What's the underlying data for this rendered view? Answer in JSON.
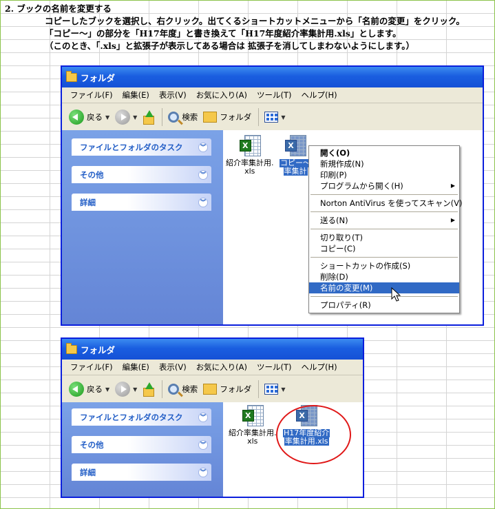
{
  "instructions": {
    "title": "2. ブックの名前を変更する",
    "line1": "コピーしたブックを選択し、右クリック。出てくるショートカットメニューから「名前の変更」をクリック。",
    "line2": "「コピー～」の部分を「H17年度」と書き換えて「H17年度紹介率集計用.xls」とします。",
    "line3": "（このとき、「.xls」と拡張子が表示してある場合は 拡張子を消してしまわないようにします。）"
  },
  "window_top": {
    "title": "フォルダ",
    "menu": [
      "ファイル(F)",
      "編集(E)",
      "表示(V)",
      "お気に入り(A)",
      "ツール(T)",
      "ヘルプ(H)"
    ],
    "toolbar": {
      "back": "戻る",
      "search": "検索",
      "folders": "フォルダ"
    },
    "tasks": [
      "ファイルとフォルダのタスク",
      "その他",
      "詳細"
    ],
    "files": [
      {
        "name_line1": "紹介率集計用.",
        "name_line2": "xls",
        "selected": false
      },
      {
        "name_line1": "コピー～",
        "name_line2": "率集計",
        "selected": true
      }
    ],
    "context_menu": {
      "group1": [
        "開く(O)",
        "新規作成(N)",
        "印刷(P)",
        "プログラムから開く(H)"
      ],
      "group2": [
        "Norton AntiVirus を使ってスキャン(V)"
      ],
      "group3": [
        "送る(N)"
      ],
      "group4": [
        "切り取り(T)",
        "コピー(C)"
      ],
      "group5": [
        "ショートカットの作成(S)",
        "削除(D)",
        "名前の変更(M)"
      ],
      "group6": [
        "プロパティ(R)"
      ],
      "highlighted": "名前の変更(M)"
    }
  },
  "window_bottom": {
    "title": "フォルダ",
    "menu": [
      "ファイル(F)",
      "編集(E)",
      "表示(V)",
      "お気に入り(A)",
      "ツール(T)",
      "ヘルプ(H)"
    ],
    "toolbar": {
      "back": "戻る",
      "search": "検索",
      "folders": "フォルダ"
    },
    "tasks": [
      "ファイルとフォルダのタスク",
      "その他",
      "詳細"
    ],
    "files": [
      {
        "name_line1": "紹介率集計用.",
        "name_line2": "xls",
        "selected": false
      },
      {
        "name_line1": "H17年度紹介",
        "name_line2": "率集計用.xls",
        "selected": true
      }
    ]
  },
  "icons": {
    "folder": "folder-icon",
    "back": "back-arrow-icon",
    "forward": "forward-arrow-icon",
    "up": "folder-up-icon",
    "search": "search-icon",
    "views": "views-icon",
    "chevron": "chevron-down-icon",
    "excel_file": "excel-file-icon"
  },
  "colors": {
    "title_bar": "#1a5ee0",
    "task_pane": "#7ba2e7",
    "selection": "#316ac5",
    "annotation_circle": "#e01818"
  }
}
